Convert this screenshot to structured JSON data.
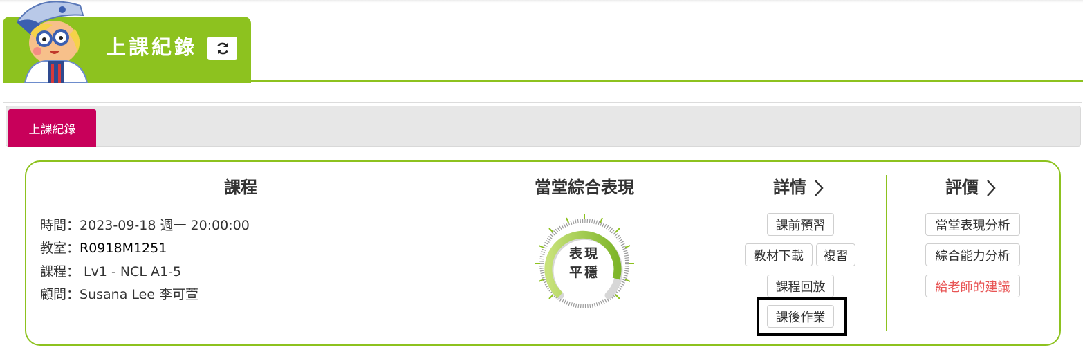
{
  "header": {
    "title": "上課紀錄",
    "refresh_icon": "refresh-icon",
    "accent_color": "#8dc21f"
  },
  "tabs": [
    {
      "label": "上課紀錄",
      "active": true,
      "color": "#c8005a"
    }
  ],
  "course": {
    "heading": "課程",
    "rows": [
      {
        "label": "時間：",
        "value": "2023-09-18 週一 20:00:00"
      },
      {
        "label": "教室：",
        "value": "R0918M1251"
      },
      {
        "label": "課程：",
        "value": " Lv1 - NCL A1-5"
      },
      {
        "label": "顧問：",
        "value": "Susana Lee 李可萱"
      }
    ]
  },
  "performance": {
    "heading": "當堂綜合表現",
    "gauge_line1": "表現",
    "gauge_line2": "平穩"
  },
  "details": {
    "heading": "詳情",
    "buttons": {
      "preview": "課前預習",
      "material_download": "教材下載",
      "review": "複習",
      "replay": "課程回放",
      "homework": "課後作業"
    }
  },
  "evaluation": {
    "heading": "評價",
    "buttons": {
      "in_class_analysis": "當堂表現分析",
      "ability_analysis": "綜合能力分析",
      "suggestion_to_teacher": "給老師的建議"
    },
    "suggestion_color": "#e85555"
  }
}
